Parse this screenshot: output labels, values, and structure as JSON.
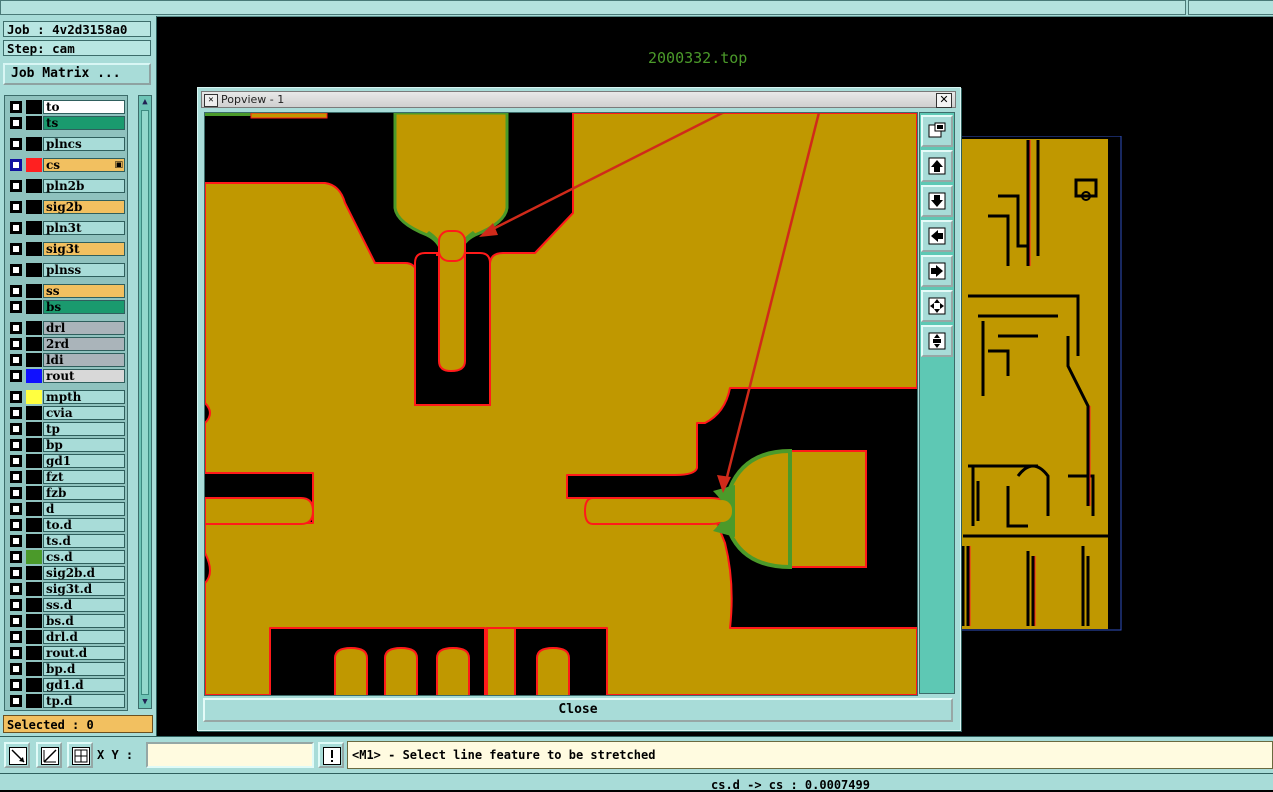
{
  "left_panel": {
    "job_label": "Job : 4v2d3158a0",
    "step_label": "Step: cam",
    "job_matrix_button": "Job Matrix ...",
    "layers": [
      {
        "name": "to",
        "bg": "#ffffff",
        "swatch": "#000000",
        "marker": ""
      },
      {
        "name": "ts",
        "bg": "#1a9a6e",
        "swatch": "#000000",
        "marker": ""
      },
      {
        "name": "plncs",
        "bg": "#a8dcd8",
        "swatch": "#000000",
        "marker": ""
      },
      {
        "name": "cs",
        "bg": "#f2c060",
        "swatch": "#ff2020",
        "marker": "▣",
        "active": true
      },
      {
        "name": "pln2b",
        "bg": "#a8dcd8",
        "swatch": "#000000",
        "marker": ""
      },
      {
        "name": "sig2b",
        "bg": "#f2c060",
        "swatch": "#000000",
        "marker": ""
      },
      {
        "name": "pln3t",
        "bg": "#a8dcd8",
        "swatch": "#000000",
        "marker": ""
      },
      {
        "name": "sig3t",
        "bg": "#f2c060",
        "swatch": "#000000",
        "marker": ""
      },
      {
        "name": "plnss",
        "bg": "#a8dcd8",
        "swatch": "#000000",
        "marker": ""
      },
      {
        "name": "ss",
        "bg": "#f2c060",
        "swatch": "#000000",
        "marker": ""
      },
      {
        "name": "bs",
        "bg": "#1a9a6e",
        "swatch": "#000000",
        "marker": ""
      },
      {
        "name": "drl",
        "bg": "#aab4ba",
        "swatch": "#000000",
        "marker": ""
      },
      {
        "name": "2rd",
        "bg": "#aab4ba",
        "swatch": "#000000",
        "marker": ""
      },
      {
        "name": "ldi",
        "bg": "#aab4ba",
        "swatch": "#000000",
        "marker": ""
      },
      {
        "name": "rout",
        "bg": "#d8d8d8",
        "swatch": "#1010ff",
        "marker": ""
      },
      {
        "name": "mpth",
        "bg": "#a8dcd8",
        "swatch": "#ffff40",
        "marker": ""
      },
      {
        "name": "cvia",
        "bg": "#a8dcd8",
        "swatch": "#000000",
        "marker": ""
      },
      {
        "name": "tp",
        "bg": "#a8dcd8",
        "swatch": "#000000",
        "marker": ""
      },
      {
        "name": "bp",
        "bg": "#a8dcd8",
        "swatch": "#000000",
        "marker": ""
      },
      {
        "name": "gd1",
        "bg": "#a8dcd8",
        "swatch": "#000000",
        "marker": ""
      },
      {
        "name": "fzt",
        "bg": "#a8dcd8",
        "swatch": "#000000",
        "marker": ""
      },
      {
        "name": "fzb",
        "bg": "#a8dcd8",
        "swatch": "#000000",
        "marker": ""
      },
      {
        "name": "d",
        "bg": "#a8dcd8",
        "swatch": "#000000",
        "marker": ""
      },
      {
        "name": "to.d",
        "bg": "#a8dcd8",
        "swatch": "#000000",
        "marker": ""
      },
      {
        "name": "ts.d",
        "bg": "#a8dcd8",
        "swatch": "#000000",
        "marker": ""
      },
      {
        "name": "cs.d",
        "bg": "#a8dcd8",
        "swatch": "#4b9a2a",
        "marker": ""
      },
      {
        "name": "sig2b.d",
        "bg": "#a8dcd8",
        "swatch": "#000000",
        "marker": ""
      },
      {
        "name": "sig3t.d",
        "bg": "#a8dcd8",
        "swatch": "#000000",
        "marker": ""
      },
      {
        "name": "ss.d",
        "bg": "#a8dcd8",
        "swatch": "#000000",
        "marker": ""
      },
      {
        "name": "bs.d",
        "bg": "#a8dcd8",
        "swatch": "#000000",
        "marker": ""
      },
      {
        "name": "drl.d",
        "bg": "#a8dcd8",
        "swatch": "#000000",
        "marker": ""
      },
      {
        "name": "rout.d",
        "bg": "#a8dcd8",
        "swatch": "#000000",
        "marker": ""
      },
      {
        "name": "bp.d",
        "bg": "#a8dcd8",
        "swatch": "#000000",
        "marker": ""
      },
      {
        "name": "gd1.d",
        "bg": "#a8dcd8",
        "swatch": "#000000",
        "marker": ""
      },
      {
        "name": "tp.d",
        "bg": "#a8dcd8",
        "swatch": "#000000",
        "marker": ""
      }
    ],
    "selected_label": "Selected : 0"
  },
  "canvas": {
    "filename": "2000332.top",
    "copper_color": "#c09800",
    "outline_color": "#ff1a1a",
    "drill_color": "#4b9a2a",
    "arrow_color": "#d02a1a"
  },
  "popview": {
    "title": "Popview - 1",
    "close_button": "Close",
    "tools": [
      "zoom-window-icon",
      "pan-up-icon",
      "pan-down-icon",
      "pan-left-icon",
      "pan-right-icon",
      "zoom-fit-icon",
      "zoom-center-icon"
    ]
  },
  "bottom_bar": {
    "xy_label": "X Y :",
    "xy_value": "",
    "message": "<M1> - Select line feature to be stretched"
  },
  "status": {
    "text": "cs.d -> cs : 0.0007499"
  }
}
